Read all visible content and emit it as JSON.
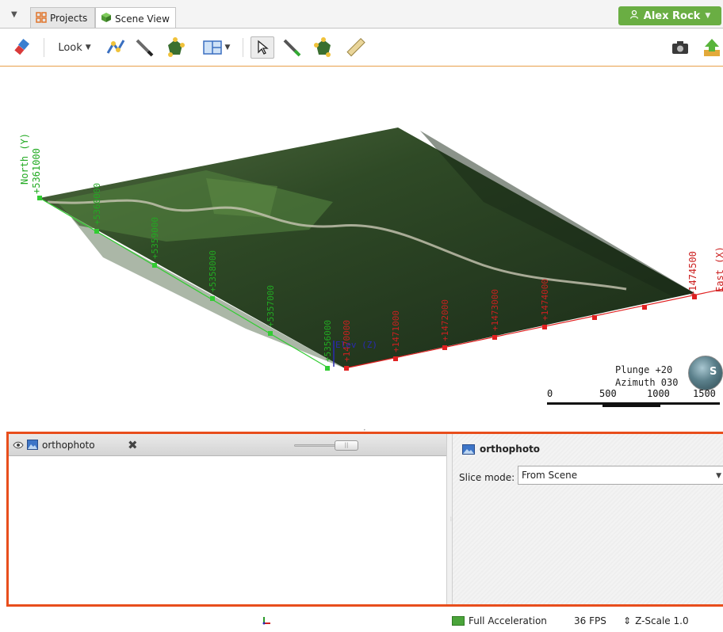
{
  "tabs": [
    {
      "label": "Projects"
    },
    {
      "label": "Scene View"
    }
  ],
  "user": {
    "name": "Alex Rock"
  },
  "toolbar": {
    "look_label": "Look"
  },
  "scene": {
    "north_axis_title": "North (Y)",
    "north_first_tick": "+5361000",
    "north_ticks": [
      "+5360000",
      "+5359000",
      "+5358000",
      "+5357000",
      "+5356000"
    ],
    "east_ticks": [
      "+1470000",
      "+1471000",
      "+1472000",
      "+1473000",
      "+1474000",
      "+1474500"
    ],
    "east_axis_title": "East (X)",
    "elev_label": "Elev (Z)",
    "plunge": "Plunge +20",
    "azimuth": "Azimuth 030",
    "scale_labels": [
      "0",
      "500",
      "1000",
      "1500"
    ],
    "compass_letter": "S"
  },
  "layers": [
    {
      "name": "orthophoto",
      "visible": true
    }
  ],
  "properties": {
    "title": "orthophoto",
    "slice_mode_label": "Slice mode:",
    "slice_mode_value": "From Scene"
  },
  "status": {
    "acceleration": "Full Acceleration",
    "fps": "36 FPS",
    "zscale": "Z-Scale 1.0"
  },
  "colors": {
    "user_button": "#6aae43",
    "panel_border": "#e84e1c",
    "north_axis": "#33cc33",
    "east_axis": "#e02020"
  }
}
